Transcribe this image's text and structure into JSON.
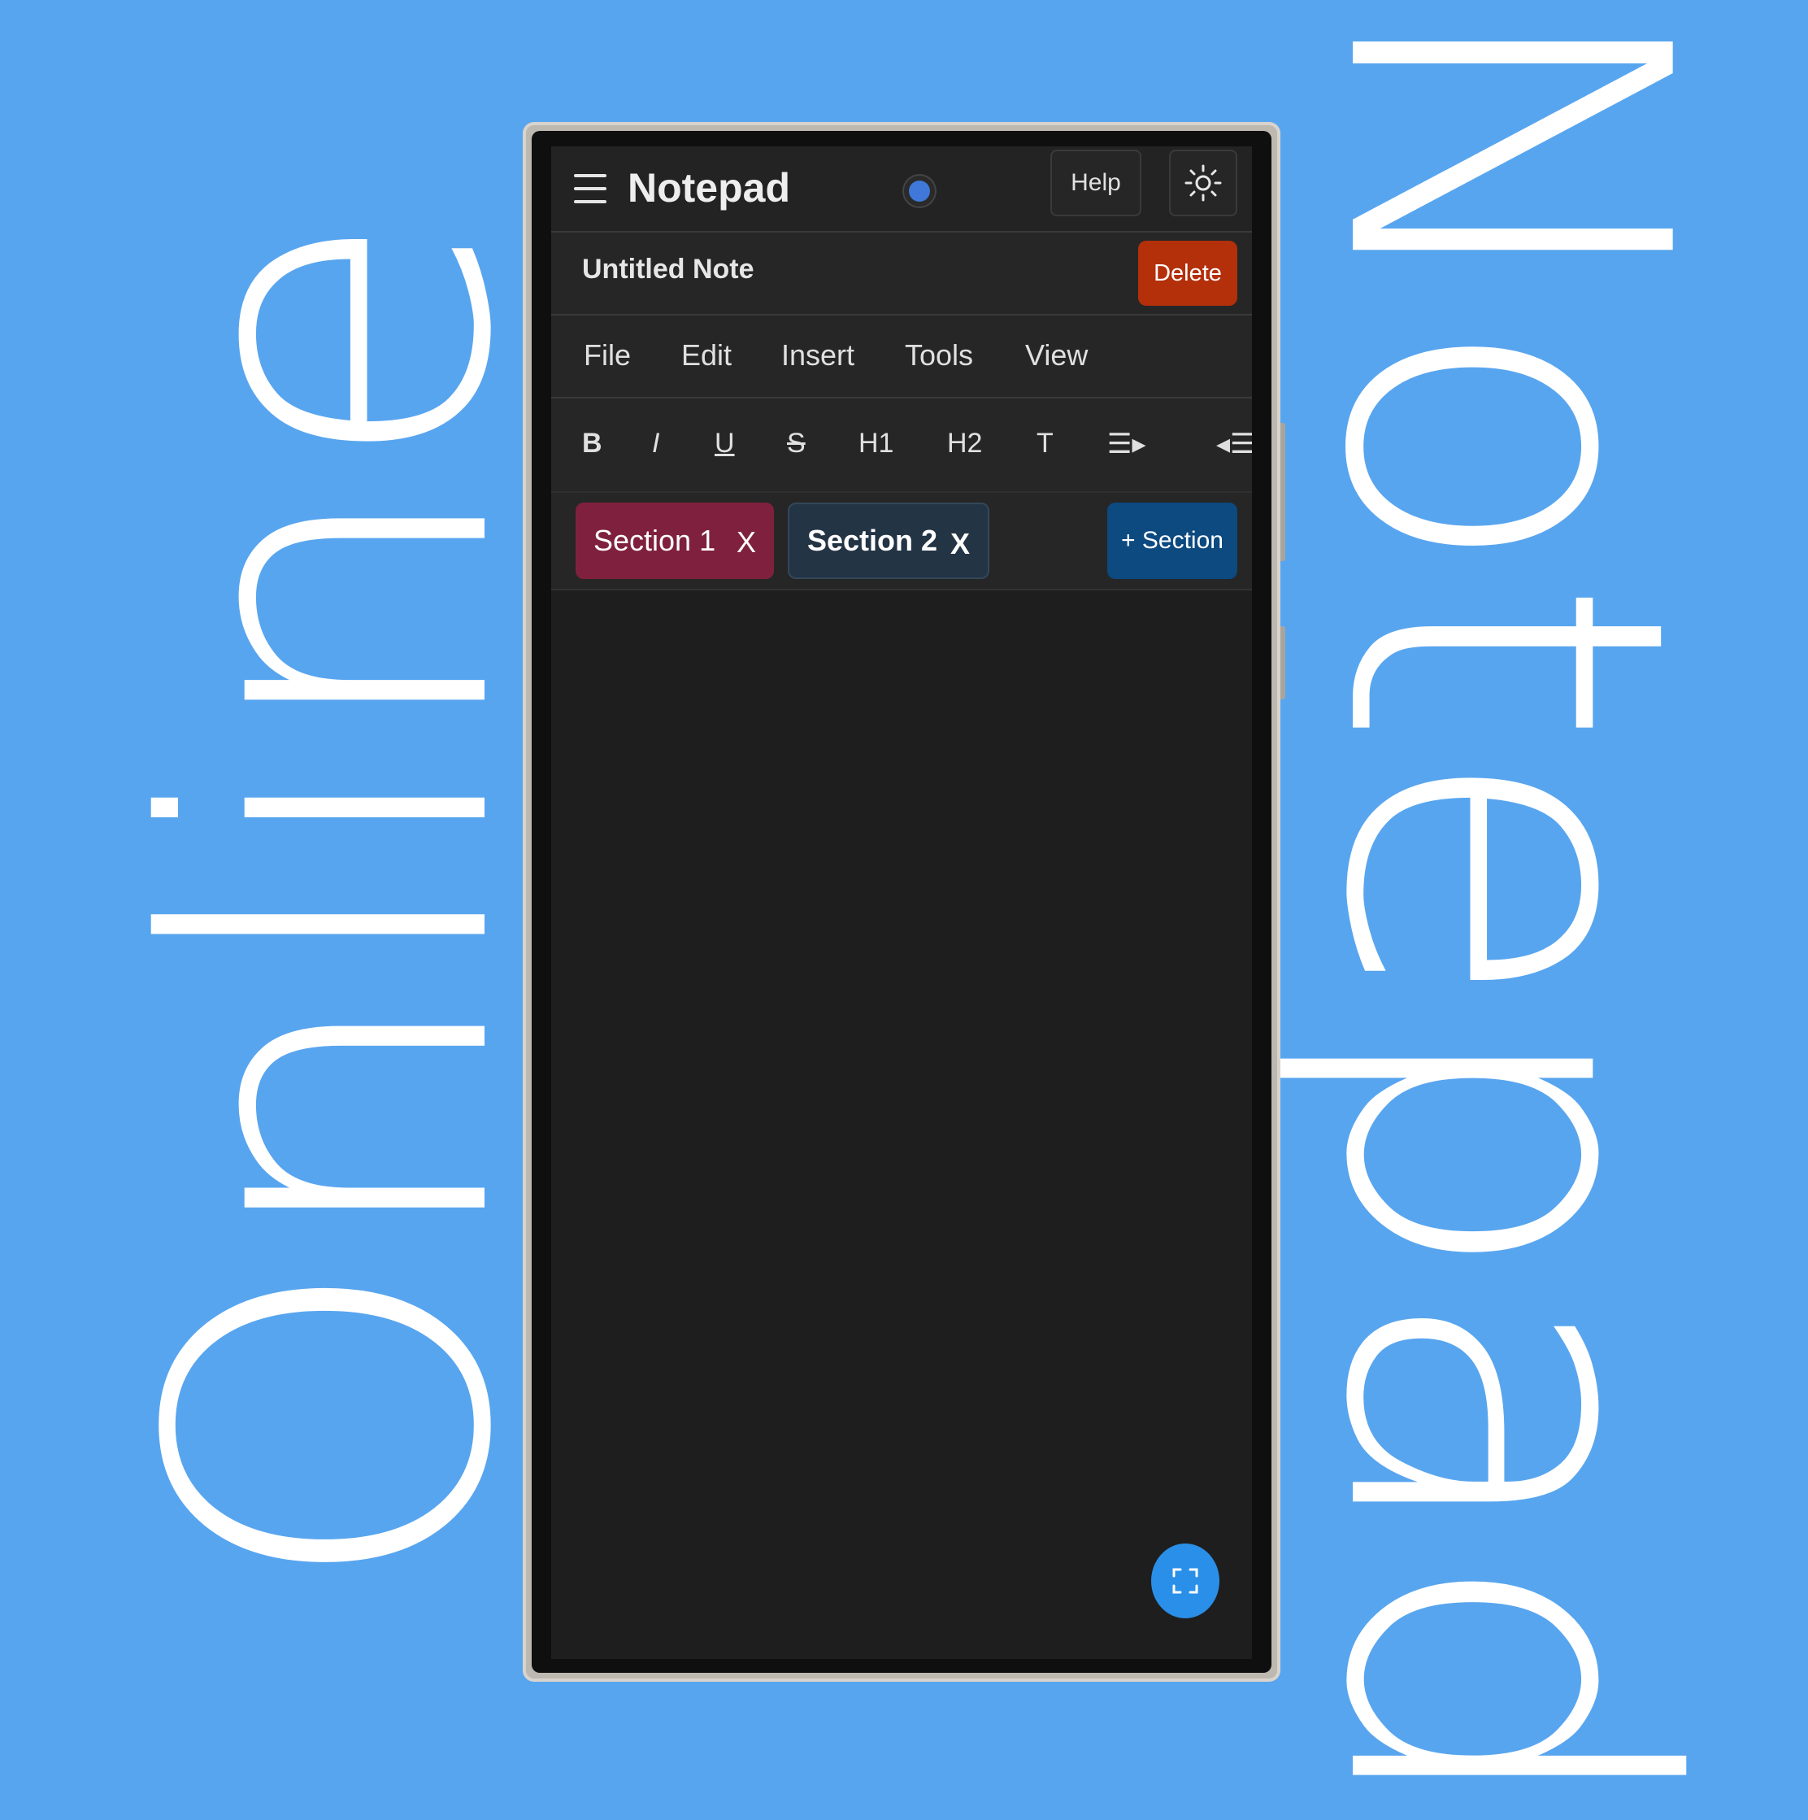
{
  "background_text": {
    "left_word": "Online",
    "right_word": "Notepad"
  },
  "colors": {
    "background": "#58a5ef",
    "screen": "#1e1e1e",
    "delete": "#b3300b",
    "section1": "#7f213e",
    "section2": "#233444",
    "add_section": "#0c4a80",
    "fab": "#2a8fe8"
  },
  "header": {
    "menu_icon": "hamburger-menu-icon",
    "title": "Notepad",
    "help_label": "Help",
    "theme_icon": "sun-icon"
  },
  "note": {
    "title": "Untitled Note",
    "delete_label": "Delete"
  },
  "menu": {
    "items": [
      "File",
      "Edit",
      "Insert",
      "Tools",
      "View"
    ]
  },
  "toolbar": {
    "bold": "B",
    "italic": "I",
    "underline": "U",
    "strike": "S",
    "h1": "H1",
    "h2": "H2",
    "text": "T",
    "indent": "☰▸",
    "outdent": "◂☰"
  },
  "sections": {
    "tabs": [
      {
        "label": "Section 1",
        "close": "X"
      },
      {
        "label": "Section 2",
        "close": "X"
      }
    ],
    "add_label": "+ Section"
  },
  "fab": {
    "icon": "fullscreen-icon"
  }
}
